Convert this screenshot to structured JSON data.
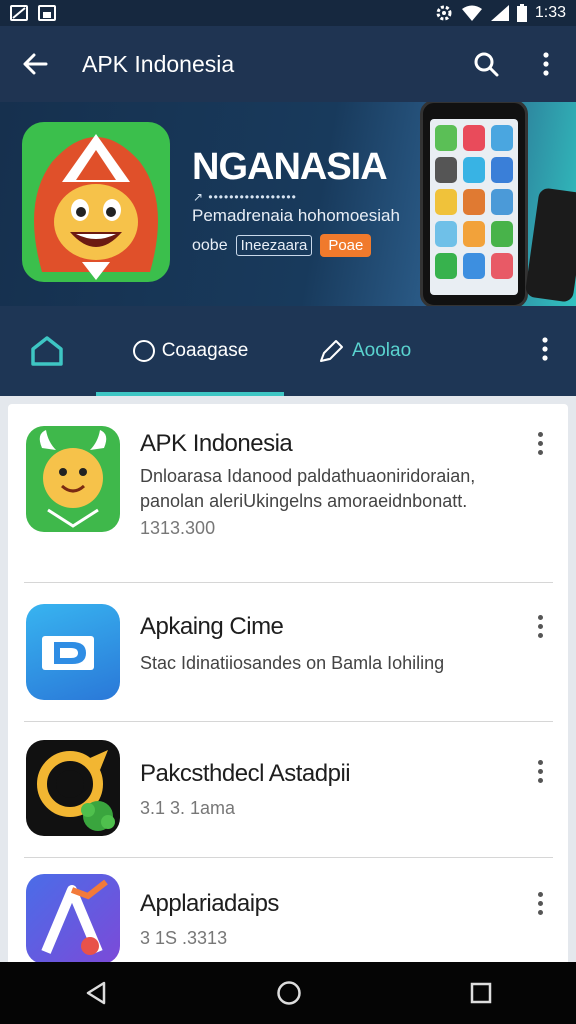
{
  "status_bar": {
    "time": "1:33",
    "icons": [
      "gallery-icon",
      "storage-icon",
      "settings-icon",
      "wifi-icon",
      "signal-icon",
      "battery-icon"
    ]
  },
  "app_bar": {
    "title": "APK Indonesia",
    "icons": [
      "back-arrow-icon",
      "search-icon",
      "more-vert-icon"
    ]
  },
  "banner": {
    "heading": "NGANASIA",
    "subline_small": "↗ •••••••••••••••••",
    "subline": "Pemadrenaia hohomoesiah",
    "tagline_text": "oobe",
    "tagline_tag": "Ineezaara",
    "tagline_pill": "Poae"
  },
  "tabs": {
    "home_icon": "home-icon",
    "items": [
      {
        "label": "Coaagase",
        "icon": "circle-icon",
        "selected": true
      },
      {
        "label": "Aoolao",
        "icon": "pen-icon",
        "selected": false
      }
    ]
  },
  "apps": [
    {
      "name": "APK Indonesia",
      "desc": "Dnloarasa Idanood paldathuaoniridoraian, panolan aleriUkingelns amoraeidnbonatt.",
      "meta": "1313.300",
      "icon": "mascot-icon"
    },
    {
      "name": "Apkaing Cime",
      "desc": "Stac Idinatiiosandes on Bamla Iohiling",
      "meta": "",
      "icon": "d-logo-icon"
    },
    {
      "name": "Pakcsthdecl Astadpii",
      "desc": "",
      "meta": "3.1 3. 1ama",
      "icon": "ring-logo-icon"
    },
    {
      "name": "Applariadaips",
      "desc": "",
      "meta": "3 1S .3313",
      "icon": "a-logo-icon"
    }
  ],
  "colors": {
    "app_bar": "#1f3452",
    "accent": "#3ec6c4",
    "pill": "#f07a2c"
  },
  "nav": [
    "back-triangle-icon",
    "home-circle-icon",
    "recents-square-icon"
  ]
}
